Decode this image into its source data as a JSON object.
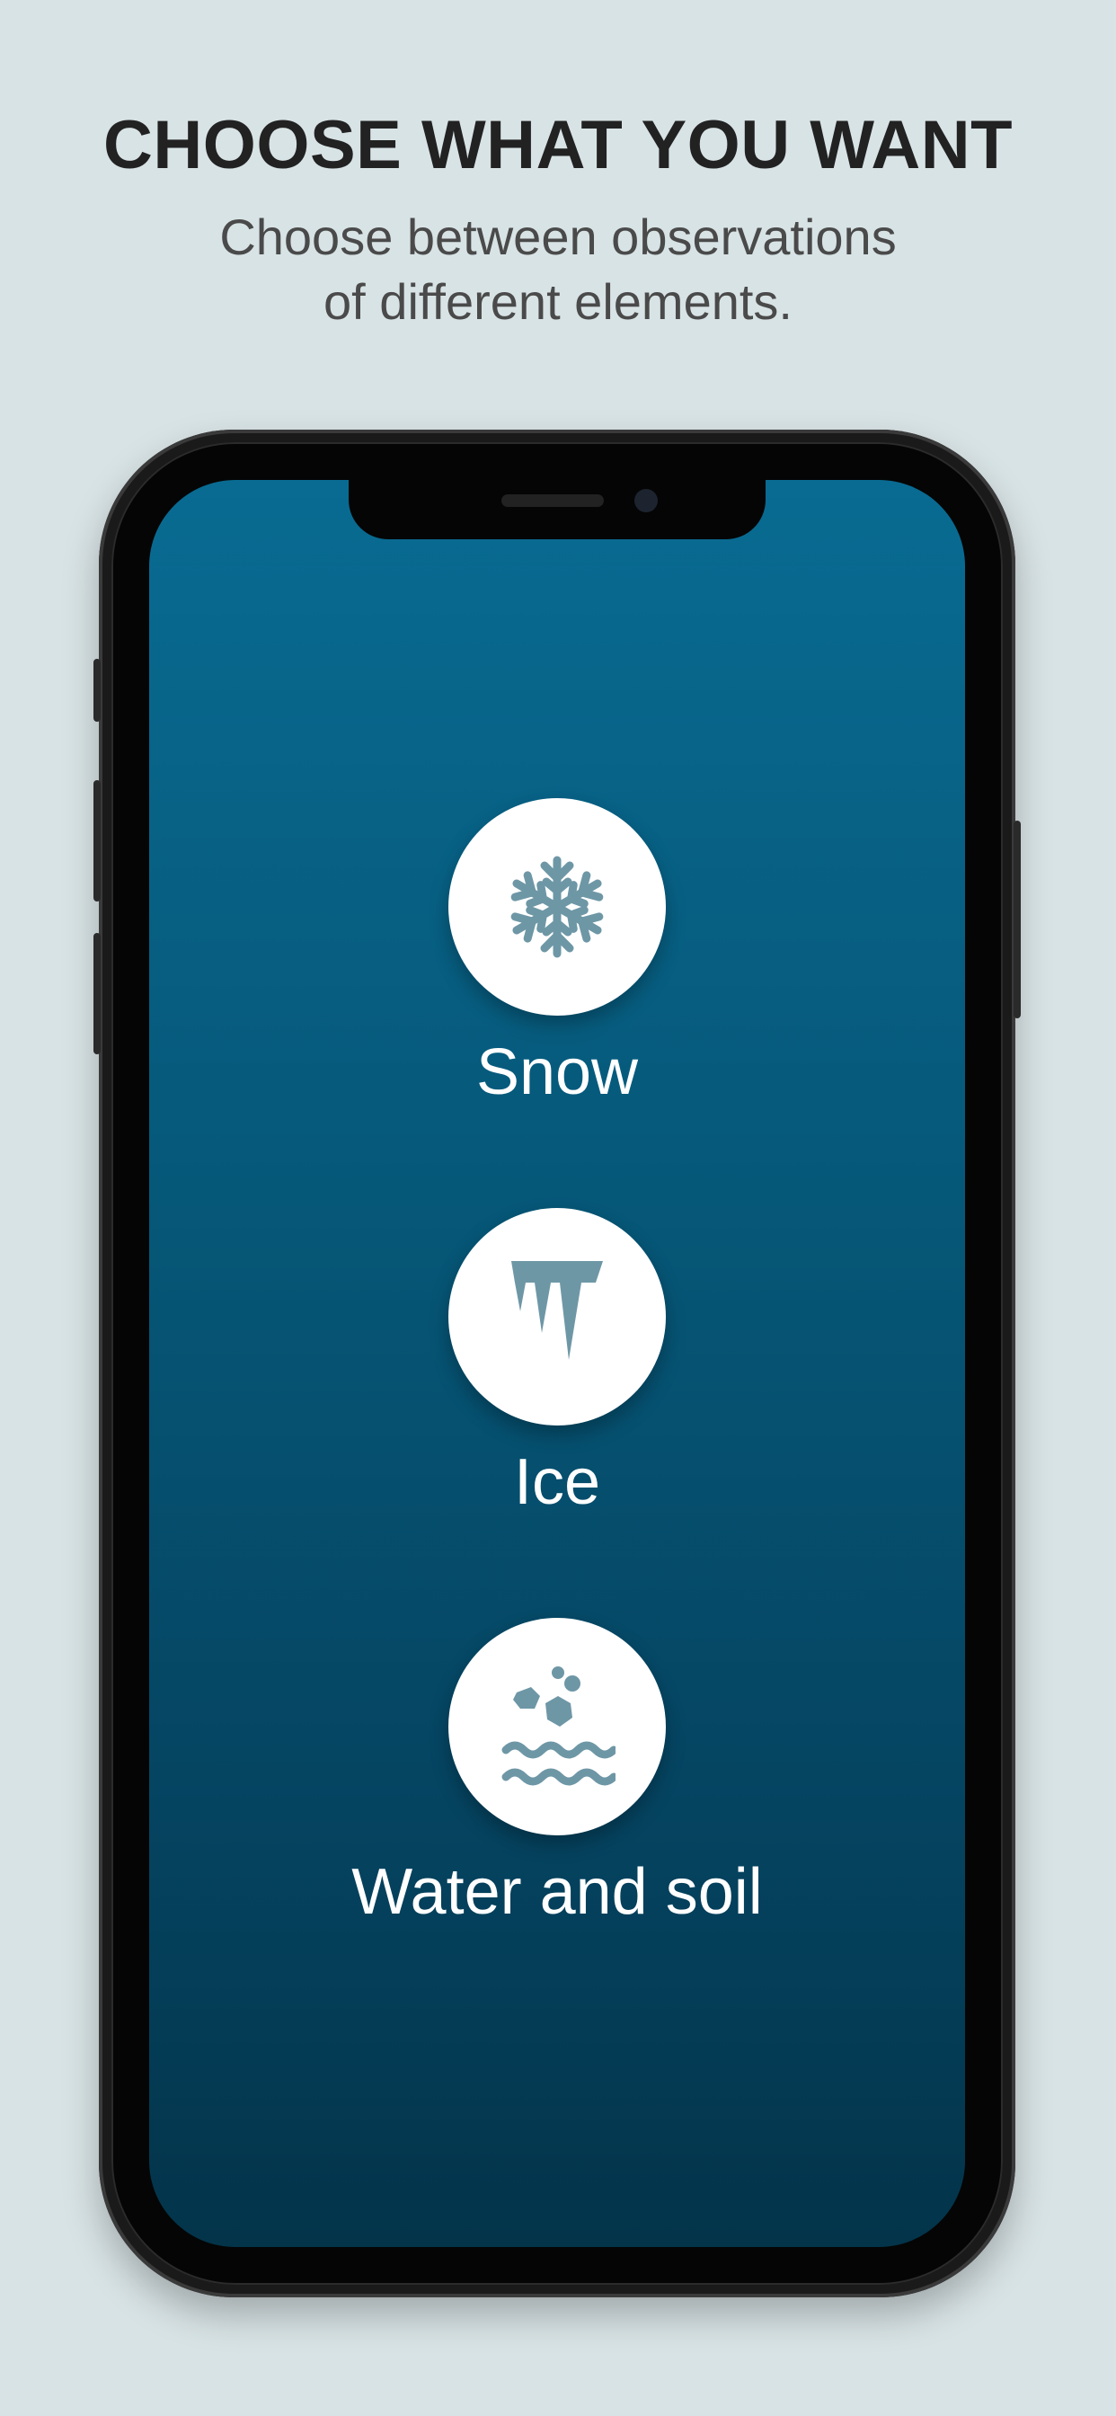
{
  "header": {
    "title": "CHOOSE WHAT YOU WANT",
    "subtitle_lines": [
      "Choose between observations",
      "of different elements."
    ]
  },
  "options": [
    {
      "label": "Snow",
      "icon": "snowflake-icon"
    },
    {
      "label": "Ice",
      "icon": "icicle-icon"
    },
    {
      "label": "Water and soil",
      "icon": "water-soil-icon"
    }
  ],
  "colors": {
    "background": "#d8e3e5",
    "screen_top": "#096b92",
    "screen_bottom": "#03344a",
    "icon": "#6e97a6",
    "option_circle": "#ffffff",
    "option_text": "#ffffff"
  }
}
